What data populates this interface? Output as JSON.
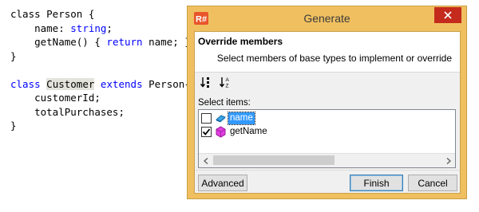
{
  "editor": {
    "lines": [
      [
        {
          "t": "class Person {"
        }
      ],
      [
        {
          "t": "    name: "
        },
        {
          "t": "string",
          "c": "kw"
        },
        {
          "t": ";"
        }
      ],
      [
        {
          "t": "    getName() { "
        },
        {
          "t": "return",
          "c": "kw"
        },
        {
          "t": " name; }"
        }
      ],
      [
        {
          "t": "}"
        }
      ],
      [
        {
          "t": ""
        }
      ],
      [
        {
          "t": "class",
          "c": "kw"
        },
        {
          "t": " "
        },
        {
          "t": "Customer",
          "c": "hl"
        },
        {
          "t": " "
        },
        {
          "t": "extends",
          "c": "kw"
        },
        {
          "t": " Person{"
        }
      ],
      [
        {
          "t": "    customerId;"
        }
      ],
      [
        {
          "t": "    totalPurchases;"
        }
      ],
      [
        {
          "t": "}"
        }
      ]
    ]
  },
  "dialog": {
    "title": "Generate",
    "header_title": "Override members",
    "header_subtitle": "Select members of base types to implement or override",
    "toolbar": [
      "sort-ascending-icon",
      "sort-alphabetical-icon"
    ],
    "select_label": "Select items:",
    "items": [
      {
        "label": "name",
        "checked": false,
        "selected": true,
        "icon": "property-icon"
      },
      {
        "label": "getName",
        "checked": true,
        "selected": false,
        "icon": "method-icon"
      }
    ],
    "buttons": {
      "advanced": "Advanced",
      "finish": "Finish",
      "cancel": "Cancel"
    }
  },
  "colors": {
    "frame": "#f0c060",
    "keyword": "#0000ff",
    "selection": "#3399ff",
    "close": "#c42b1c"
  }
}
